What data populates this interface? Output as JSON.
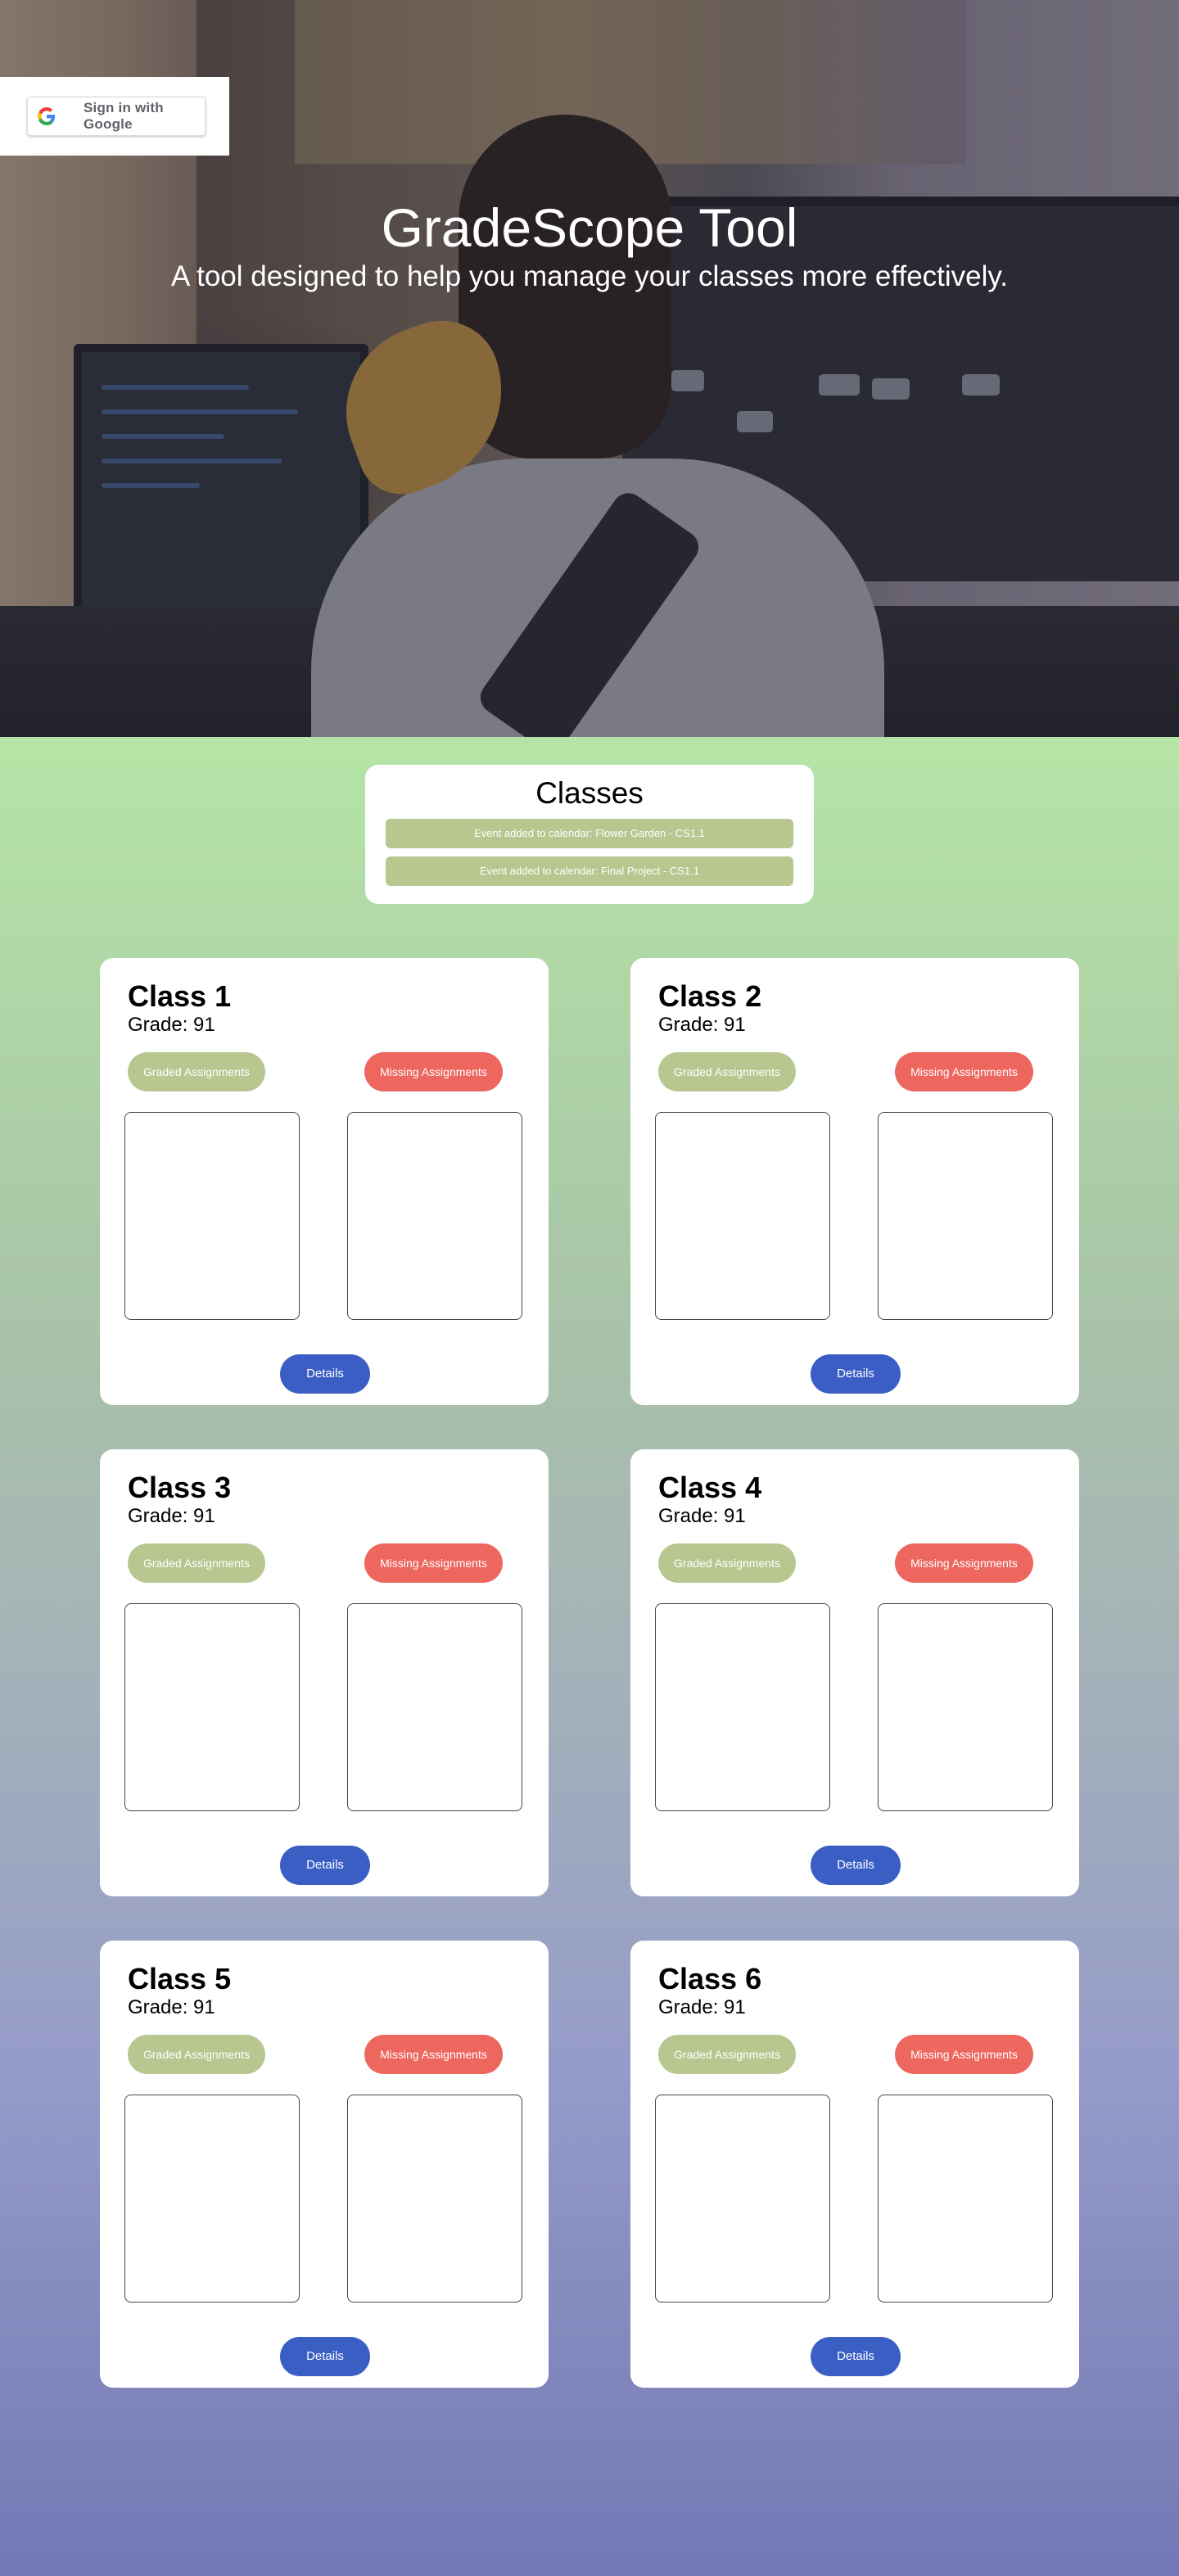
{
  "auth": {
    "signin_label": "Sign in with Google"
  },
  "hero": {
    "title": "GradeScope Tool",
    "subtitle": "A tool designed to help you manage your classes more effectively."
  },
  "classes_panel": {
    "title": "Classes",
    "events": [
      "Event added to calendar: Flower Garden - CS1.1",
      "Event added to calendar: Final Project - CS1.1"
    ]
  },
  "cards": [
    {
      "title": "Class 1",
      "grade": "Grade: 91",
      "graded_label": "Graded Assignments",
      "missing_label": "Missing Assignments",
      "details_label": "Details"
    },
    {
      "title": "Class 2",
      "grade": "Grade: 91",
      "graded_label": "Graded Assignments",
      "missing_label": "Missing Assignments",
      "details_label": "Details"
    },
    {
      "title": "Class 3",
      "grade": "Grade: 91",
      "graded_label": "Graded Assignments",
      "missing_label": "Missing Assignments",
      "details_label": "Details"
    },
    {
      "title": "Class 4",
      "grade": "Grade: 91",
      "graded_label": "Graded Assignments",
      "missing_label": "Missing Assignments",
      "details_label": "Details"
    },
    {
      "title": "Class 5",
      "grade": "Grade: 91",
      "graded_label": "Graded Assignments",
      "missing_label": "Missing Assignments",
      "details_label": "Details"
    },
    {
      "title": "Class 6",
      "grade": "Grade: 91",
      "graded_label": "Graded Assignments",
      "missing_label": "Missing Assignments",
      "details_label": "Details"
    }
  ],
  "colors": {
    "graded": "#b8c690",
    "missing": "#ed675f",
    "details": "#3a5ec4"
  },
  "icons": {
    "signin": "google-g-icon"
  }
}
